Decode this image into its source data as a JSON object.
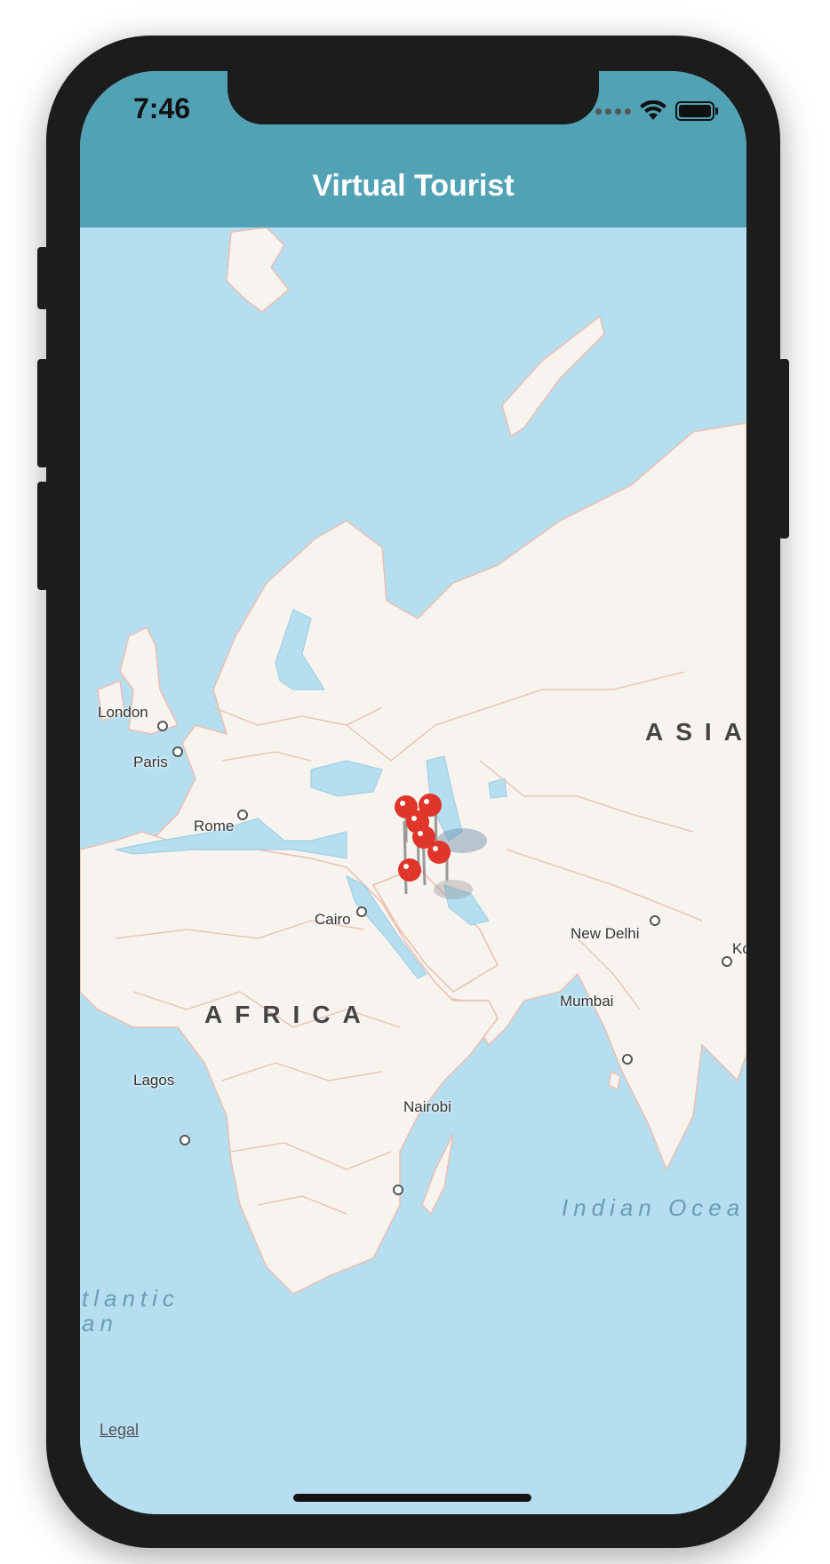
{
  "status_bar": {
    "time": "7:46",
    "icons": [
      "signal-dots-icon",
      "wifi-icon",
      "battery-icon"
    ]
  },
  "nav_bar": {
    "title": "Virtual Tourist",
    "color": "#52a2b5"
  },
  "map": {
    "cities": {
      "london": "London",
      "paris": "Paris",
      "rome": "Rome",
      "cairo": "Cairo",
      "new_delhi": "New Delhi",
      "mumbai": "Mumbai",
      "lagos": "Lagos",
      "nairobi": "Nairobi",
      "kolkata_partial": "Ko"
    },
    "regions": {
      "asia": "ASIA",
      "africa": "AFRICA"
    },
    "oceans": {
      "indian": "Indian Ocea",
      "atlantic_line1": "tlantic",
      "atlantic_line2": "an"
    },
    "pin_count": 6,
    "pin_color": "#e0352b",
    "water_color": "#b5def0",
    "land_color": "#f7f3ee",
    "border_color": "#eabfb0"
  },
  "legal_label": "Legal"
}
